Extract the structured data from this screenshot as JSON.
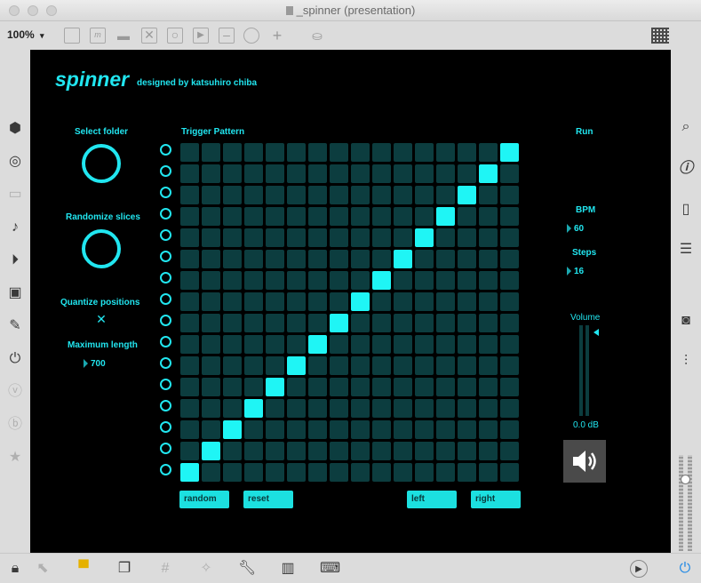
{
  "window": {
    "title": "_spinner (presentation)"
  },
  "toolbar": {
    "zoom": "100%",
    "zoom_arrow": "▾"
  },
  "patcher": {
    "brand": "spinner",
    "byline": "designed by katsuhiro chiba",
    "select_folder_label": "Select folder",
    "randomize_slices_label": "Randomize slices",
    "quantize_label": "Quantize  positions",
    "quantize_mark": "✕",
    "max_length_label": "Maximum length",
    "max_length_value": "700",
    "trigger_pattern_label": "Trigger Pattern",
    "run_label": "Run",
    "bpm_label": "BPM",
    "bpm_value": "60",
    "steps_label": "Steps",
    "steps_value": "16",
    "volume_label": "Volume",
    "volume_value": "0.0 dB",
    "buttons": {
      "random": "random",
      "reset": "reset",
      "left": "left",
      "right": "right"
    },
    "grid": {
      "rows": 16,
      "cols": 16,
      "active_cells": [
        [
          0,
          15
        ],
        [
          1,
          14
        ],
        [
          2,
          13
        ],
        [
          3,
          12
        ],
        [
          4,
          11
        ],
        [
          5,
          10
        ],
        [
          6,
          9
        ],
        [
          7,
          8
        ],
        [
          8,
          7
        ],
        [
          9,
          6
        ],
        [
          10,
          5
        ],
        [
          11,
          4
        ],
        [
          12,
          3
        ],
        [
          13,
          2
        ],
        [
          14,
          1
        ],
        [
          15,
          0
        ]
      ]
    }
  },
  "left_sidebar": [
    "cube-icon",
    "target-icon",
    "window-icon",
    "music-note-icon",
    "play-step-icon",
    "image-icon",
    "paperclip-icon",
    "plug-icon",
    "v-icon",
    "b-icon",
    "star-icon"
  ],
  "right_sidebar": [
    "search-icon",
    "info-icon",
    "book-icon",
    "list-icon",
    "camera-icon",
    "sliders-icon"
  ],
  "bottom_bar": [
    "lock-icon",
    "cursor-icon",
    "presentation-icon",
    "windows-icon",
    "grid-icon",
    "patch-cord-icon",
    "wrench-icon",
    "piano-icon",
    "keyboard-icon",
    "audio-engine-icon",
    "power-icon"
  ],
  "colors": {
    "accent": "#21e6f0",
    "cell_off": "#0c3d3f",
    "cell_on": "#1ff5f5",
    "canvas": "#000000",
    "power": "#1e88e5"
  }
}
